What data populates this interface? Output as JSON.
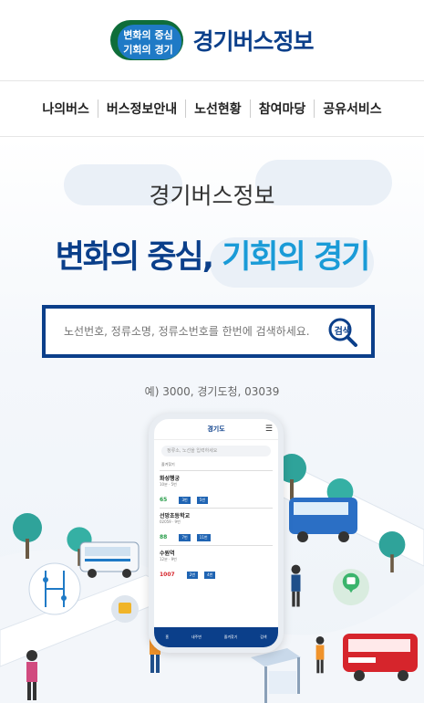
{
  "header": {
    "logo_line1": "변화의 중심",
    "logo_line2": "기회의 경기",
    "logo_name": "경기버스정보"
  },
  "nav": {
    "items": [
      {
        "label": "나의버스"
      },
      {
        "label": "버스정보안내"
      },
      {
        "label": "노선현황"
      },
      {
        "label": "참여마당"
      },
      {
        "label": "공유서비스"
      }
    ]
  },
  "hero": {
    "subtitle": "경기버스정보",
    "title_part1": "변화의 중심,",
    "title_part2": "기회의 경기",
    "search_placeholder": "노선번호, 정류소명, 정류소번호를 한번에 검색하세요.",
    "search_button": "검색",
    "example": "예) 3000, 경기도청, 03039"
  },
  "phone": {
    "header": "경기도",
    "search_hint": "정류소, 노선을 입력하세요",
    "label": "즐겨찾기",
    "stops": [
      {
        "name": "화성행궁",
        "sub": "10분 · 5번",
        "bus": "65",
        "pills": [
          "3번",
          "5번"
        ]
      },
      {
        "name": "선망초등학교",
        "sub": "02059 · 9번",
        "bus": "88",
        "pills": [
          "7번",
          "11번"
        ]
      },
      {
        "name": "수원역",
        "sub": "12분 · 9번",
        "bus": "1007",
        "pills": [
          "2번",
          "4번"
        ]
      }
    ],
    "footer": [
      "홈",
      "내주변",
      "즐겨찾기",
      "검색"
    ]
  },
  "colors": {
    "brand_navy": "#0b3f8a",
    "brand_sky": "#1a9bd7"
  }
}
